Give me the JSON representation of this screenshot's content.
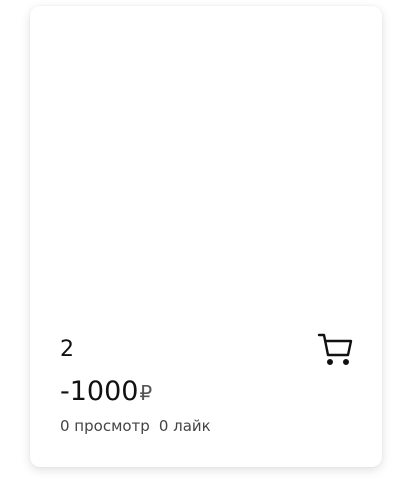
{
  "product_card": {
    "title": "2",
    "price": "-1000",
    "currency": "₽",
    "views_label": "0 просмотр",
    "likes_label": "0 лайк",
    "cart_icon": "shopping-cart-icon"
  }
}
